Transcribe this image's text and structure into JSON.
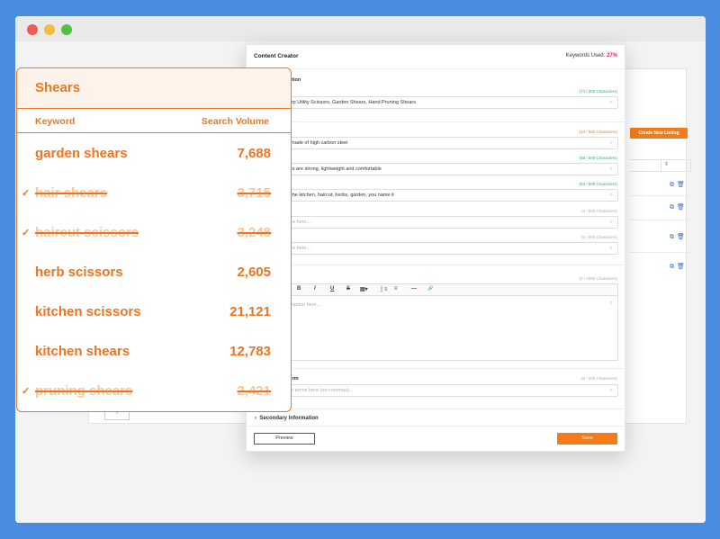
{
  "window": {
    "buttons": [
      "close",
      "minimize",
      "maximize"
    ]
  },
  "background_panel": {
    "create_button": "Create New Listing",
    "sort_icon": "⇕",
    "row_icons": [
      "copy-icon",
      "trash-icon"
    ],
    "paginator": "›"
  },
  "modal": {
    "title": "Content Creator",
    "keywords_used_label": "Keywords Used:",
    "keywords_used_value": "27%",
    "section_primary": "Primary Information",
    "title_count": "(74 / 200 Characters)",
    "title_value": "Sharp Utility Scissors, Garden Shears, Hand Pruning Shears",
    "bullet_counts": [
      "(43 / 500 Characters)",
      "(58 / 500 Characters)",
      "(63 / 500 Characters)",
      "(0 / 500 Characters)",
      "(0 / 500 Characters)"
    ],
    "bullets": [
      "...e made of high carbon steel",
      "...des are strong, lightweight and comfortable",
      "...n the kitchen, haircut, herbs, garden, you name it",
      "...ture here...",
      "...ture here..."
    ],
    "description_count": "(0 / 2000 Characters)",
    "description_placeholder": "...scription here...",
    "editor_tools": [
      "B",
      "I",
      "U",
      "S",
      "▤▾",
      "⋮≡",
      "≡",
      "—",
      "🔗"
    ],
    "search_term_label": "...Term",
    "search_term_count": "(0 / 250 Characters)",
    "search_term_placeholder": "...rch terms here (no commas)...",
    "secondary_label": "Secondary Information",
    "preview_button": "Preview",
    "save_button": "Save",
    "colors": {
      "accent": "#f47b18",
      "percent": "#e8275d",
      "count_ok": "#2fae69"
    }
  },
  "keyword_card": {
    "title": "Shears",
    "col_keyword": "Keyword",
    "col_volume": "Search Volume",
    "rows": [
      {
        "keyword": "garden shears",
        "volume": "7,688",
        "used": false
      },
      {
        "keyword": "hair shears",
        "volume": "3,715",
        "used": true
      },
      {
        "keyword": "haircut scissors",
        "volume": "3,248",
        "used": true
      },
      {
        "keyword": "herb scissors",
        "volume": "2,605",
        "used": false
      },
      {
        "keyword": "kitchen scissors",
        "volume": "21,121",
        "used": false
      },
      {
        "keyword": "kitchen shears",
        "volume": "12,783",
        "used": false
      },
      {
        "keyword": "pruning shears",
        "volume": "2,421",
        "used": true
      }
    ],
    "check_icon": "✓",
    "accent_color": "#f0771d"
  }
}
